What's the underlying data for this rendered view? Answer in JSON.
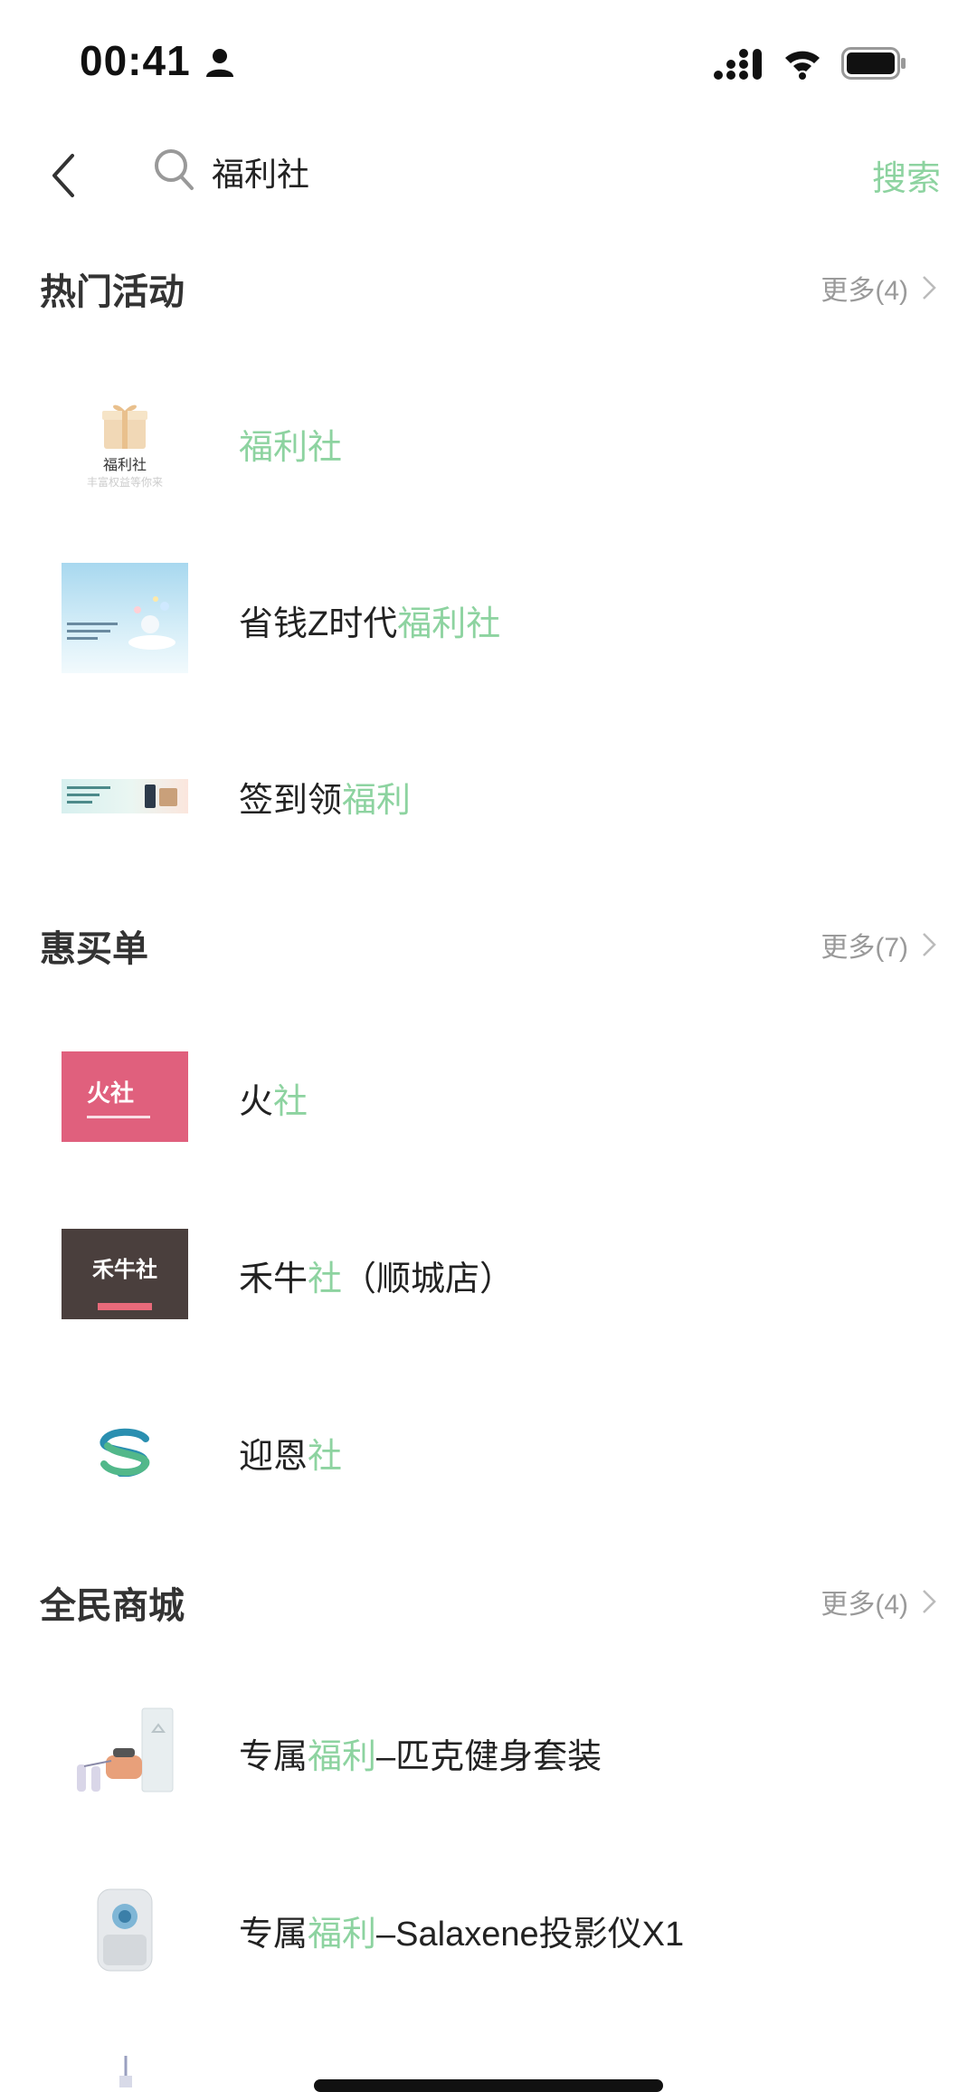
{
  "status_bar": {
    "time": "00:41"
  },
  "search": {
    "query": "福利社",
    "search_button": "搜索"
  },
  "sections": {
    "hot_activities": {
      "title": "热门活动",
      "more": "更多(4)",
      "items": [
        {
          "pre": "",
          "hl": "福利社",
          "post": "",
          "thumb_text": "福利社",
          "thumb_sub": "丰富权益等你来"
        },
        {
          "pre": "省钱Z时代",
          "hl": "福利社",
          "post": ""
        },
        {
          "pre": "签到领",
          "hl": "福利",
          "post": ""
        }
      ]
    },
    "deals": {
      "title": "惠买单",
      "more": "更多(7)",
      "items": [
        {
          "pre": "火",
          "hl": "社",
          "post": "",
          "thumb_text": "火社"
        },
        {
          "pre": "禾牛",
          "hl": "社",
          "post": "（顺城店）",
          "thumb_text": "禾牛社"
        },
        {
          "pre": "迎恩",
          "hl": "社",
          "post": ""
        }
      ]
    },
    "mall": {
      "title": "全民商城",
      "more": "更多(4)",
      "items": [
        {
          "pre": "专属",
          "hl": "福利",
          "post": "–匹克健身套装"
        },
        {
          "pre": "专属",
          "hl": "福利",
          "post": "–Salaxene投影仪X1"
        }
      ]
    }
  },
  "colors": {
    "accent": "#8dd3a0",
    "text": "#222222",
    "muted": "#9a9a9a"
  }
}
